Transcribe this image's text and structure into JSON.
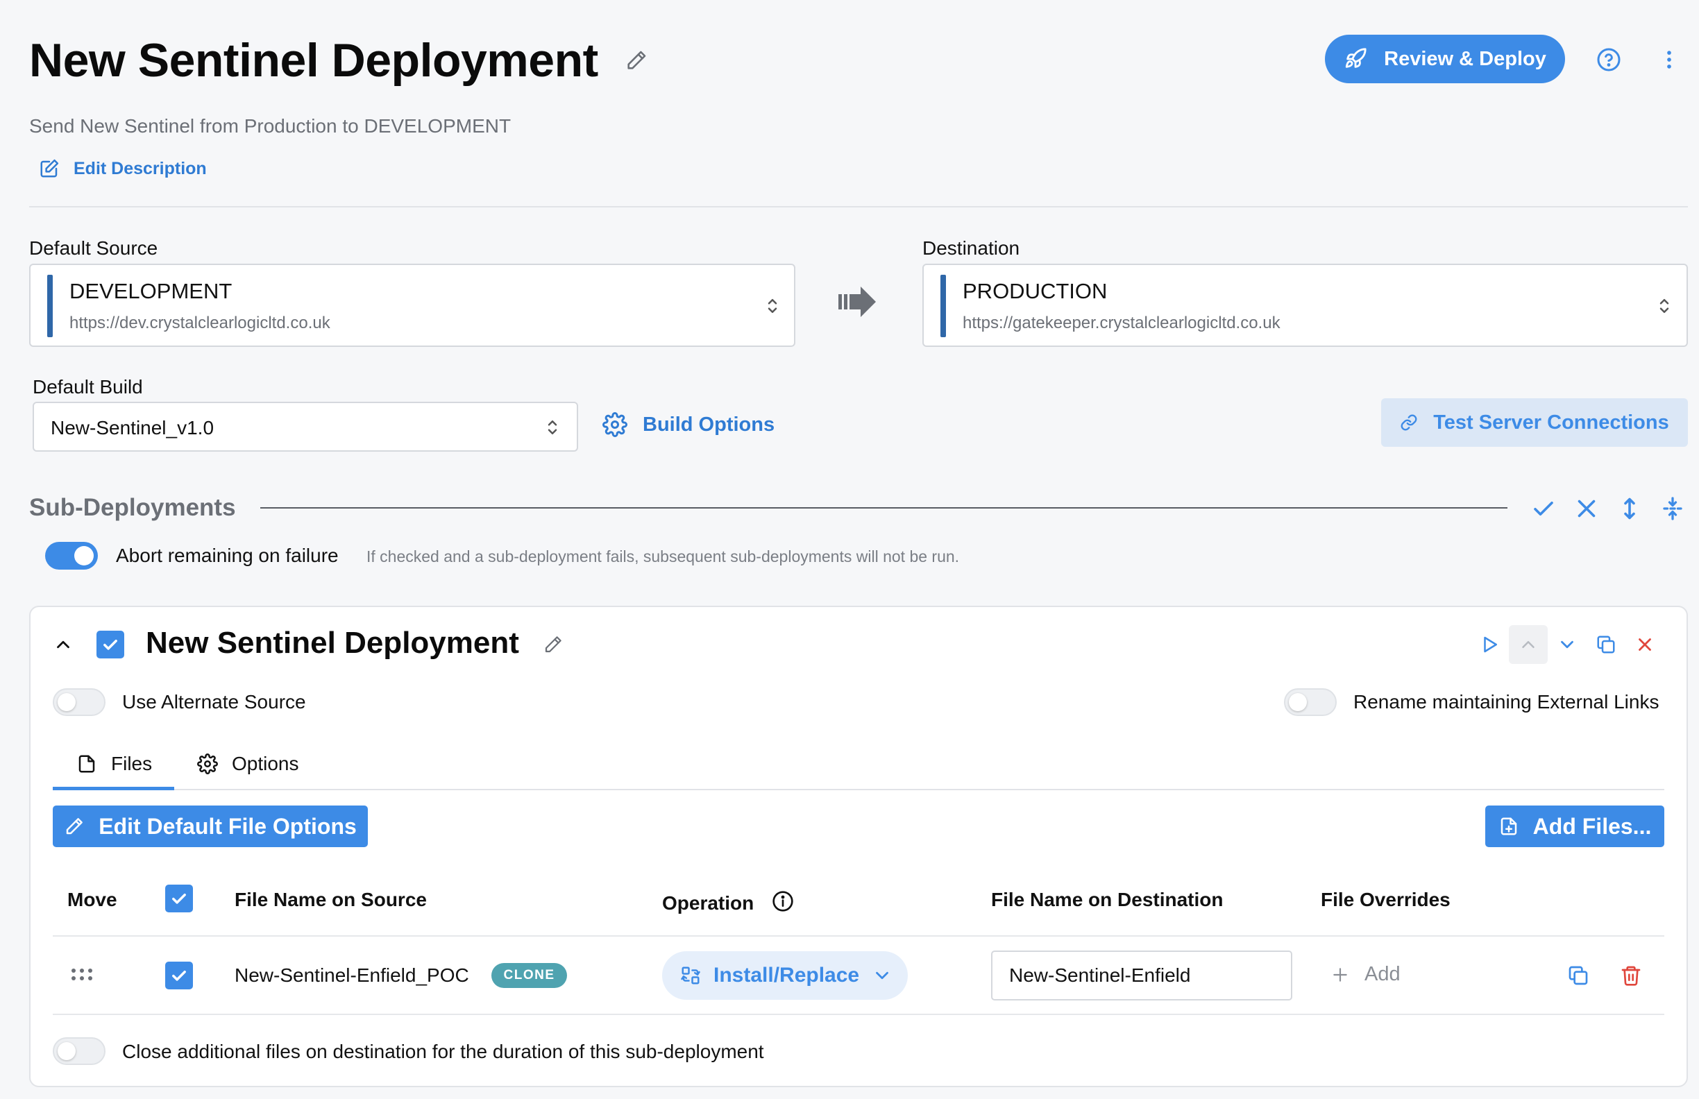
{
  "header": {
    "title": "New Sentinel Deployment",
    "description": "Send New Sentinel from Production to DEVELOPMENT",
    "edit_description_label": "Edit Description",
    "review_deploy_label": "Review & Deploy"
  },
  "servers": {
    "source_label": "Default Source",
    "source_name": "DEVELOPMENT",
    "source_url": "https://dev.crystalclearlogicltd.co.uk",
    "destination_label": "Destination",
    "destination_name": "PRODUCTION",
    "destination_url": "https://gatekeeper.crystalclearlogicltd.co.uk"
  },
  "build": {
    "label": "Default Build",
    "value": "New-Sentinel_v1.0",
    "options_label": "Build Options",
    "test_connections_label": "Test Server Connections"
  },
  "sub_deployments": {
    "title": "Sub-Deployments",
    "abort_label": "Abort remaining on failure",
    "abort_hint": "If checked and a sub-deployment fails, subsequent sub-deployments will not be run.",
    "abort_enabled": true
  },
  "card": {
    "title": "New Sentinel Deployment",
    "checked": true,
    "use_alternate_source_label": "Use Alternate Source",
    "use_alternate_source": false,
    "rename_external_links_label": "Rename maintaining External Links",
    "rename_external_links": false,
    "tabs": [
      {
        "label": "Files",
        "icon": "file-icon",
        "active": true
      },
      {
        "label": "Options",
        "icon": "gear-icon",
        "active": false
      }
    ],
    "edit_default_options_label": "Edit Default File Options",
    "add_files_label": "Add Files...",
    "table": {
      "columns": [
        "Move",
        "File Name on Source",
        "Operation",
        "File Name on Destination",
        "File Overrides"
      ],
      "rows": [
        {
          "checked": true,
          "source_name": "New-Sentinel-Enfield_POC",
          "badge": "CLONE",
          "operation": "Install/Replace",
          "destination_name": "New-Sentinel-Enfield",
          "override_label": "Add"
        }
      ]
    },
    "close_files_label": "Close additional files on destination for the duration of this sub-deployment",
    "close_files": false
  },
  "colors": {
    "accent": "#3d8be6",
    "badge": "#4fa3b0",
    "delete": "#e0463c",
    "server_bar": "#2f67a8"
  }
}
